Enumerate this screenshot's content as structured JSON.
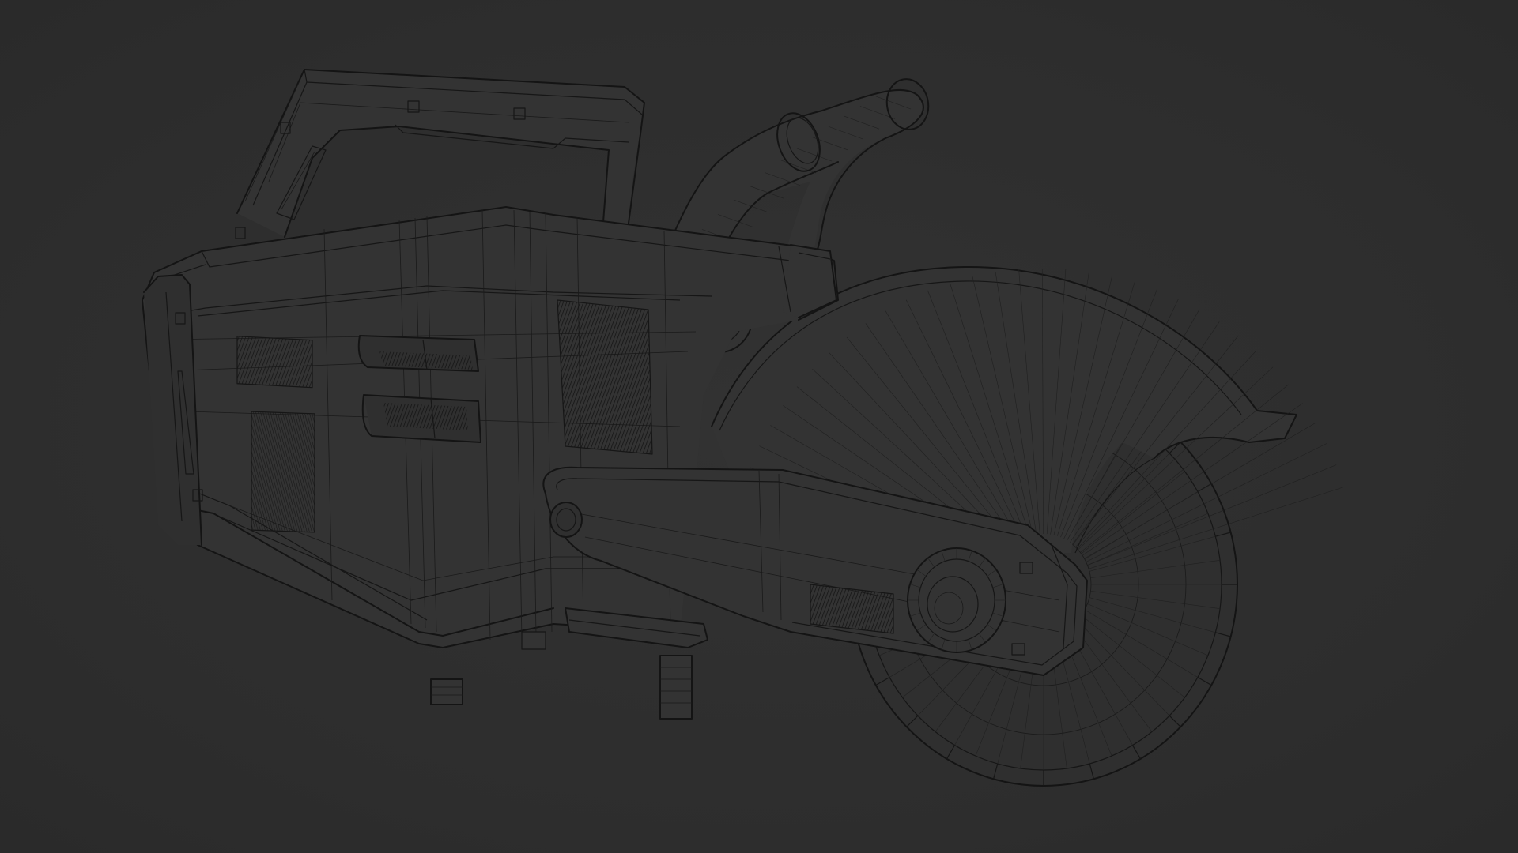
{
  "scene": {
    "subject": "cut-off-saw-wireframe",
    "background_color": "#2f2f2f",
    "wire_color": "#141414"
  }
}
